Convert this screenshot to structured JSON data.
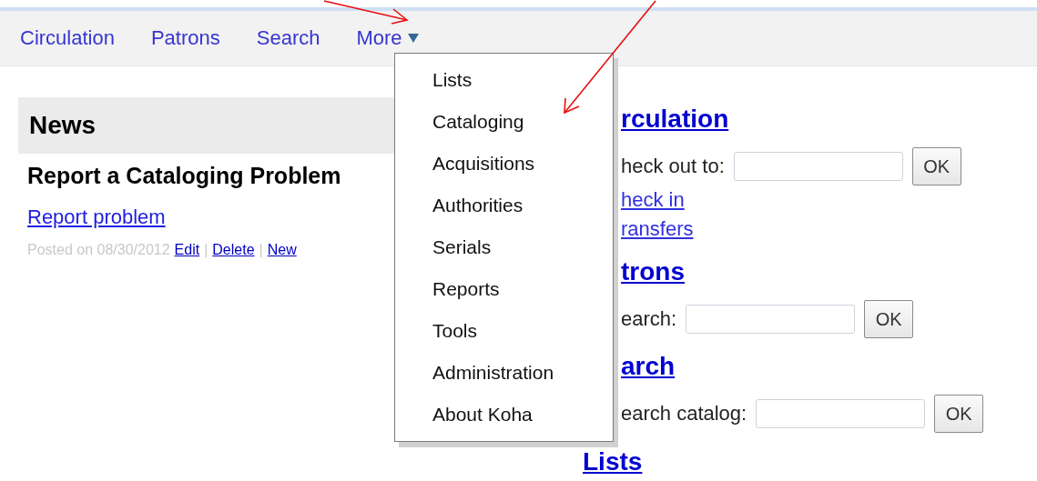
{
  "nav": {
    "items": [
      {
        "label": "Circulation",
        "kind": "link"
      },
      {
        "label": "Patrons",
        "kind": "link"
      },
      {
        "label": "Search",
        "kind": "link"
      },
      {
        "label": "More",
        "kind": "dropdown",
        "expanded": true
      }
    ]
  },
  "more_menu": {
    "items": [
      "Lists",
      "Cataloging",
      "Acquisitions",
      "Authorities",
      "Serials",
      "Reports",
      "Tools",
      "Administration",
      "About Koha"
    ]
  },
  "news": {
    "title": "News",
    "items": [
      {
        "heading": "Report a Cataloging Problem",
        "link": "Report problem",
        "posted": "Posted on 08/30/2012",
        "actions": [
          "Edit",
          "Delete",
          "New"
        ],
        "separator": "|"
      }
    ]
  },
  "sections": [
    {
      "heading": "rculation",
      "form": {
        "label": "heck out to:",
        "button": "OK"
      },
      "links": [
        "heck in",
        "ransfers"
      ]
    },
    {
      "heading": "trons",
      "form": {
        "label": "earch:",
        "button": "OK"
      }
    },
    {
      "heading": "arch",
      "form": {
        "label": "earch catalog:",
        "button": "OK"
      }
    },
    {
      "heading": "Lists",
      "kind": "whole"
    }
  ]
}
